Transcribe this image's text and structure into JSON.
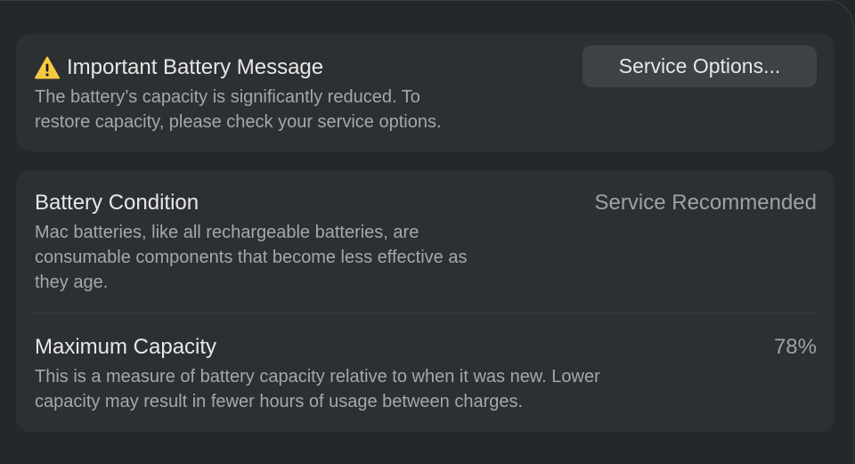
{
  "alert": {
    "icon": "warning-triangle-icon",
    "icon_color": "#f6c942",
    "title": "Important Battery Message",
    "description_line1": "The battery’s capacity is significantly reduced. To",
    "description_line2": "restore capacity, please check your service options.",
    "button_label": "Service Options..."
  },
  "battery_condition": {
    "title": "Battery Condition",
    "value": "Service Recommended",
    "description_line1": "Mac batteries, like all rechargeable batteries, are",
    "description_line2": "consumable components that become less effective as",
    "description_line3": "they age."
  },
  "maximum_capacity": {
    "title": "Maximum Capacity",
    "value": "78%",
    "description_line1": "This is a measure of battery capacity relative to when it was new. Lower",
    "description_line2": "capacity may result in fewer hours of usage between charges."
  }
}
